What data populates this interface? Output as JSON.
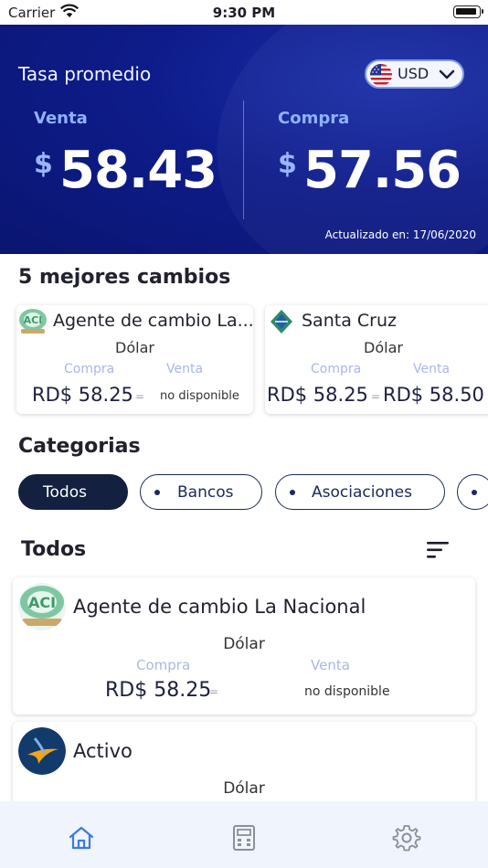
{
  "status_bar": {
    "carrier": "Carrier",
    "time": "9:30 PM"
  },
  "header": {
    "title": "Tasa promedio",
    "currency_code": "USD",
    "sell_label": "Venta",
    "sell_symbol": "$",
    "sell_value": "58.43",
    "buy_label": "Compra",
    "buy_symbol": "$",
    "buy_value": "57.56",
    "updated": "Actualizado en: 17/06/2020"
  },
  "best": {
    "title": "5 mejores cambios",
    "cards": [
      {
        "name": "Agente de cambio La...",
        "currency": "Dólar",
        "buy_label": "Compra",
        "sell_label": "Venta",
        "buy_value": "RD$ 58.25",
        "buy_trend": "=",
        "sell_value": "no disponible"
      },
      {
        "name": "Santa Cruz",
        "currency": "Dólar",
        "buy_label": "Compra",
        "sell_label": "Venta",
        "buy_value": "RD$ 58.25",
        "buy_trend": "=",
        "sell_value": "RD$ 58.50"
      }
    ]
  },
  "categories": {
    "title": "Categorias",
    "chips": [
      "Todos",
      "Bancos",
      "Asociaciones"
    ]
  },
  "list": {
    "title": "Todos",
    "items": [
      {
        "name": "Agente de cambio La Nacional",
        "currency": "Dólar",
        "buy_label": "Compra",
        "sell_label": "Venta",
        "buy_value": "RD$ 58.25",
        "buy_trend": "=",
        "sell_value": "no disponible"
      },
      {
        "name": "Activo",
        "currency": "Dólar"
      }
    ]
  },
  "colors": {
    "hero": "#0e1c8a",
    "accent": "#8fb2ff",
    "active_tab": "#3b7be0",
    "chip_active": "#13203f"
  },
  "tabs": [
    "home-icon",
    "calculator-icon",
    "gear-icon"
  ]
}
